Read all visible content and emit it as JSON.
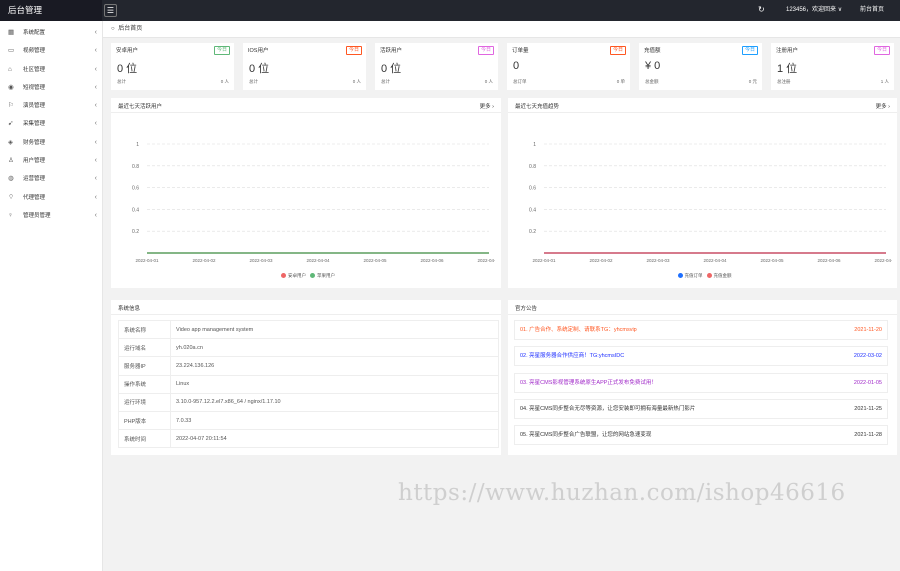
{
  "header": {
    "logo": "后台管理",
    "menu_icon": "hamburger-icon",
    "refresh_icon": "refresh-icon",
    "user": "123456，欢迎回来 ∨",
    "home": "前台首页"
  },
  "sidebar": {
    "items": [
      {
        "label": "系统配置",
        "icon": "▦"
      },
      {
        "label": "视频管理",
        "icon": "▭"
      },
      {
        "label": "社区管理",
        "icon": "⌂"
      },
      {
        "label": "短视管理",
        "icon": "◉"
      },
      {
        "label": "演员管理",
        "icon": "⚐"
      },
      {
        "label": "采集管理",
        "icon": "➹"
      },
      {
        "label": "财务管理",
        "icon": "◈"
      },
      {
        "label": "用户管理",
        "icon": "♙"
      },
      {
        "label": "运营管理",
        "icon": "◍"
      },
      {
        "label": "代理管理",
        "icon": "⌔"
      },
      {
        "label": "管理员管理",
        "icon": "♀"
      }
    ]
  },
  "breadcrumb": {
    "icon": "○",
    "label": "后台首页"
  },
  "stats": [
    {
      "label": "安卓用户",
      "badge": "今日",
      "badge_color": "#5fb878",
      "value": "0 位",
      "sub": "总计",
      "subv": "0 人"
    },
    {
      "label": "IOS用户",
      "badge": "今日",
      "badge_color": "#ff5722",
      "value": "0 位",
      "sub": "总计",
      "subv": "0 人"
    },
    {
      "label": "活跃用户",
      "badge": "今日",
      "badge_color": "#e066e0",
      "value": "0 位",
      "sub": "总计",
      "subv": "0 人"
    },
    {
      "label": "订单量",
      "badge": "今日",
      "badge_color": "#ff5722",
      "value": "0",
      "sub": "总订单",
      "subv": "0 单"
    },
    {
      "label": "充值额",
      "badge": "今日",
      "badge_color": "#1e9fff",
      "value": "¥ 0",
      "sub": "总金额",
      "subv": "0 元"
    },
    {
      "label": "注册用户",
      "badge": "今日",
      "badge_color": "#e066e0",
      "value": "1 位",
      "sub": "总注册",
      "subv": "1 人"
    }
  ],
  "charts": {
    "left_title": "最近七天活跃用户",
    "right_title": "最近七天充值趋势",
    "more": "更多 ›"
  },
  "chart_data": [
    {
      "type": "line",
      "x": [
        "2022-04-01",
        "2022-04-02",
        "2022-04-03",
        "2022-04-04",
        "2022-04-05",
        "2022-04-06",
        "2022-04-07"
      ],
      "ylim": [
        0,
        1
      ],
      "yticks": [
        "0.2",
        "0.4",
        "0.6",
        "0.8",
        "1"
      ],
      "series": [
        {
          "name": "安卓用户",
          "color": "#ee6666",
          "values": [
            0,
            0,
            0,
            0,
            0,
            0,
            0
          ]
        },
        {
          "name": "苹果用户",
          "color": "#5fb878",
          "values": [
            0,
            0,
            0,
            0,
            0,
            0,
            0
          ]
        }
      ]
    },
    {
      "type": "line",
      "x": [
        "2022-04-01",
        "2022-04-02",
        "2022-04-03",
        "2022-04-04",
        "2022-04-05",
        "2022-04-06",
        "2022-04-07"
      ],
      "ylim": [
        0,
        1
      ],
      "yticks": [
        "0.2",
        "0.4",
        "0.6",
        "0.8",
        "1"
      ],
      "series": [
        {
          "name": "充值订单",
          "color": "#1e6fff",
          "values": [
            0,
            0,
            0,
            0,
            0,
            0,
            0
          ]
        },
        {
          "name": "充值金额",
          "color": "#ee6666",
          "values": [
            0,
            0,
            0,
            0,
            0,
            0,
            0
          ]
        }
      ]
    }
  ],
  "sysinfo": {
    "title": "系统信息",
    "rows": [
      {
        "k": "系统名称",
        "v": "Video app management system"
      },
      {
        "k": "运行域名",
        "v": "yh.020a.cn"
      },
      {
        "k": "服务器IP",
        "v": "23.224.136.126"
      },
      {
        "k": "操作系统",
        "v": "Linux"
      },
      {
        "k": "运行环境",
        "v": "3.10.0-957.12.2.el7.x86_64 / nginx/1.17.10"
      },
      {
        "k": "PHP版本",
        "v": "7.0.33"
      },
      {
        "k": "系统时间",
        "v": "2022-04-07 20:11:54"
      }
    ]
  },
  "notices": {
    "title": "官方公告",
    "items": [
      {
        "text": "01. 广告合作、系统定制、请联系TG：yhcmsvip",
        "date": "2021-11-20",
        "color": "#ff5722"
      },
      {
        "text": "02. 亮星服务器合作供应商！TG:yhcmsIDC",
        "date": "2022-03-02",
        "color": "#1e2fff"
      },
      {
        "text": "03. 亮星CMS影视管理系统原生APP正式发布免费试用！",
        "date": "2022-01-05",
        "color": "#a028c8"
      },
      {
        "text": "04. 亮星CMS同步整合无尽等资源，让您安装即可拥有海量最新热门影片",
        "date": "2021-11-25",
        "color": "#333333"
      },
      {
        "text": "05. 亮星CMS同步整合广告联盟，让您的网站急速变现",
        "date": "2021-11-28",
        "color": "#333333"
      }
    ]
  },
  "watermark": "https://www.huzhan.com/ishop46616"
}
